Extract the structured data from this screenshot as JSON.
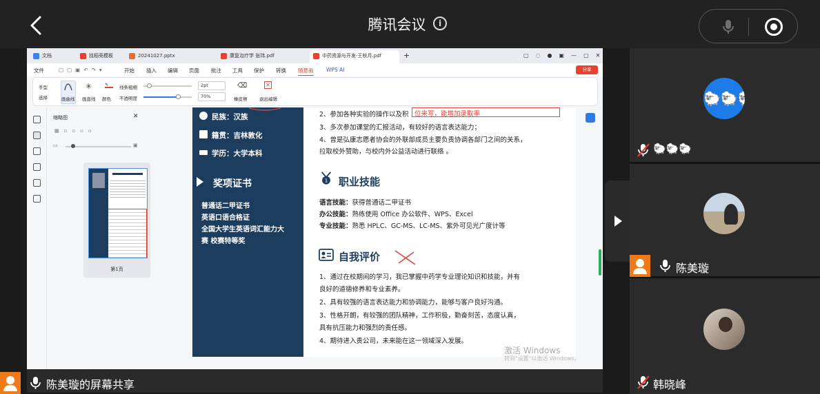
{
  "header": {
    "title": "腾讯会议",
    "info_icon": "i"
  },
  "wps": {
    "tabs": [
      "文档",
      "找稻壳模板",
      "20241027.pptx",
      "康复治疗学 张玮.pdf",
      "中药资源与开发-王秋月.pdf"
    ],
    "menu": [
      "文件",
      "开始",
      "插入",
      "编辑",
      "页面",
      "批注",
      "工具",
      "保护",
      "转换",
      "随意画",
      "WPS AI"
    ],
    "share_button": "分享",
    "ribbon": {
      "hand": "手型",
      "select": "选择",
      "curve": "画曲线",
      "line": "画直线",
      "color": "颜色",
      "line_width": "线条粗细",
      "opacity": "不透明度",
      "width_value": "2pt",
      "opacity_value": "70%",
      "eraser": "橡皮擦",
      "exit": "退出编辑"
    },
    "thumbnail_panel": {
      "title": "缩略图",
      "page_label": "第1页"
    },
    "watermark": {
      "line1": "激活 Windows",
      "line2": "转到\"设置\"以激活 Windows。"
    }
  },
  "document": {
    "sidebar": {
      "ethnicity": "民族：汉族",
      "native_place": "籍贯：吉林敦化",
      "education": "学历：大学本科",
      "awards_title": "奖项证书",
      "awards": [
        "普通话二甲证书",
        "英语口语合格证",
        "全国大学生英语词汇能力大",
        "赛 校赛特等奖"
      ]
    },
    "experience_lines": [
      "2、参加各种实验的操作以及积",
      "3、多次参加课堂的汇报活动，有较好的语言表达能力；",
      "4、曾是弘康志愿者协会的外联部成员主要负责协调各部门之间的关系，",
      "拉取校外赞助，与校内外公益活动进行联络 。"
    ],
    "annotation": "位来写，能增加录取率",
    "skills": {
      "title": "职业技能",
      "items": [
        {
          "label": "语言技能：",
          "value": "获得普通话二甲证书"
        },
        {
          "label": "办公技能：",
          "value": "熟练使用 Office 办公软件、WPS、Excel"
        },
        {
          "label": "专业技能：",
          "value": "熟悉 HPLC、GC-MS、LC-MS、紫外可见光广度计等"
        }
      ]
    },
    "self_eval": {
      "title": "自我评价",
      "lines": [
        "1、通过在校期间的学习，我已掌握中药学专业理论知识和技能，并有",
        "良好的道德修养和专业素养。",
        "2、具有较强的语言表达能力和协调能力，能够与客户良好沟通。",
        "3、性格开朗，有较强的团队精神，工作积极，勤奋刻苦，态度认真，",
        "具有抗压能力和强烈的责任感。",
        "4、期待进入贵公司，未来能在这一领域深入发展。"
      ]
    }
  },
  "participants": [
    {
      "name": "",
      "emoji": "🐑🐑🐑",
      "muted": true
    },
    {
      "name": "陈美璇",
      "muted": false
    },
    {
      "name": "韩晓峰",
      "muted": true
    }
  ],
  "share_label": "陈美璇的屏幕共享",
  "colors": {
    "accent": "#e0453a",
    "navy": "#1d3d5f",
    "orange": "#f07a19",
    "blue_avatar": "#1e7ce8"
  }
}
